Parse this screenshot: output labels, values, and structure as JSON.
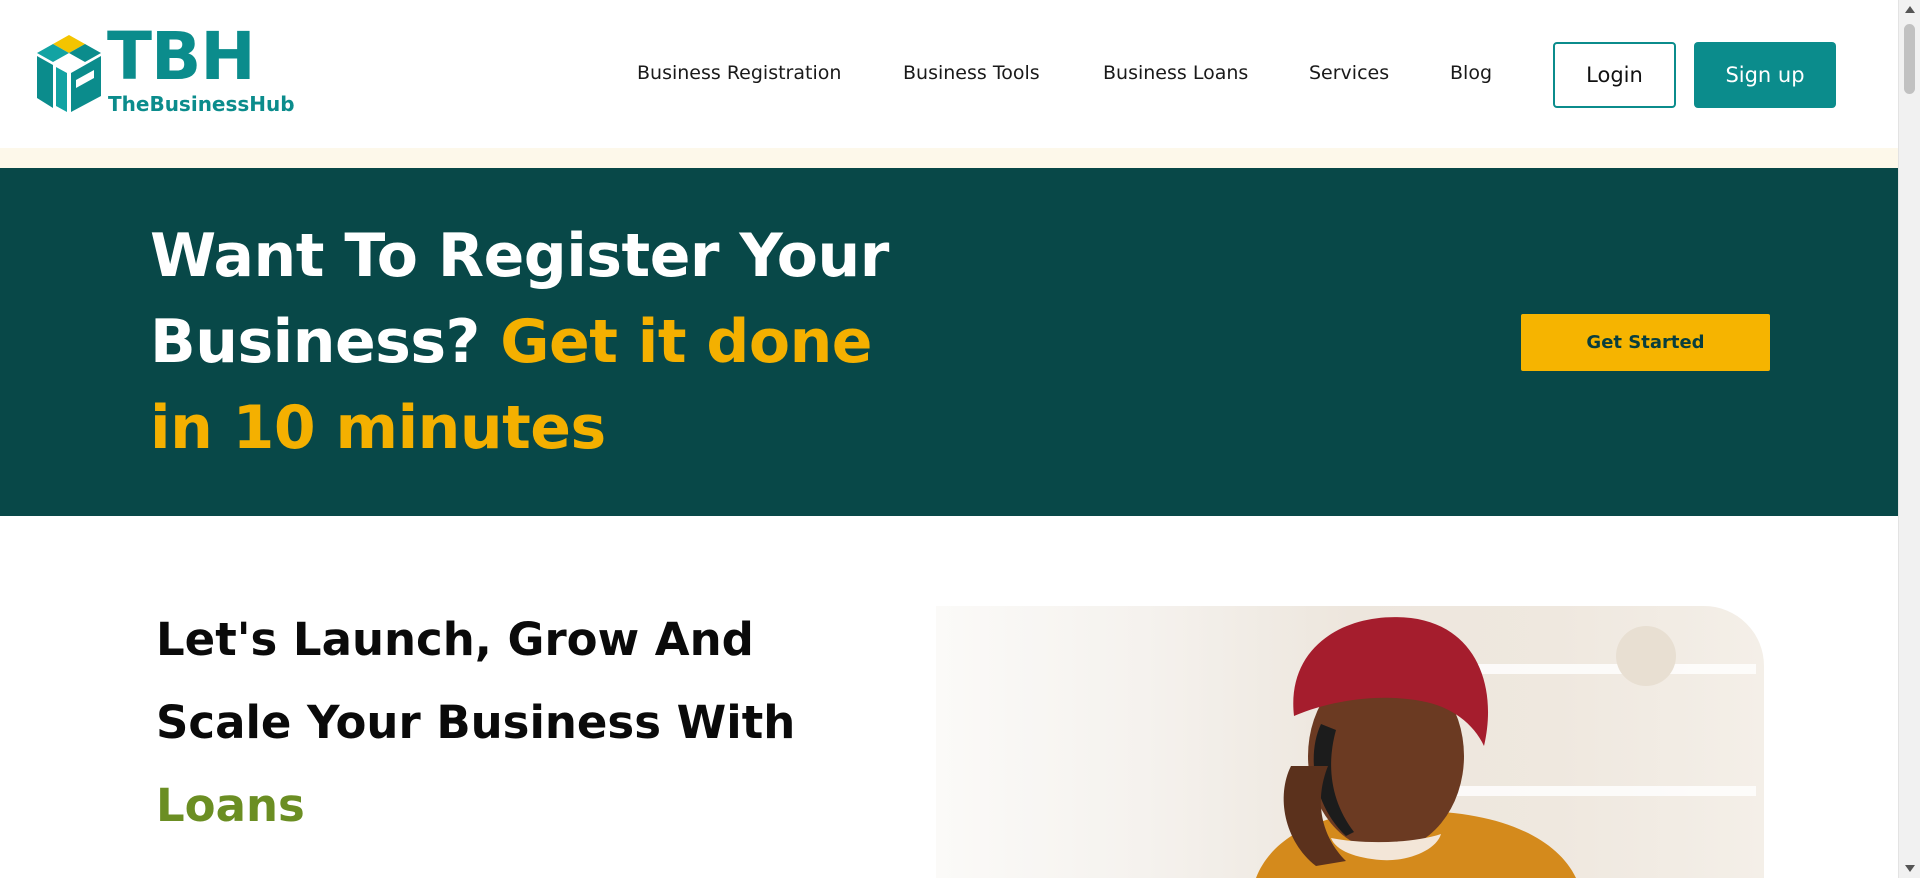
{
  "brand": {
    "logo_text": "TBH",
    "logo_subtitle": "TheBusinessHub",
    "primary_color": "#0b8c8c",
    "accent_color": "#f4b000",
    "hero_bg_color": "#084848",
    "green_accent": "#6b8e23"
  },
  "nav": {
    "items": [
      {
        "label": "Business Registration"
      },
      {
        "label": "Business Tools"
      },
      {
        "label": "Business Loans"
      },
      {
        "label": "Services"
      },
      {
        "label": "Blog"
      }
    ],
    "login_label": "Login",
    "signup_label": "Sign up"
  },
  "hero": {
    "title_white": "Want To Register Your Business? ",
    "title_highlight": "Get it done in 10 minutes",
    "cta_label": "Get Started"
  },
  "loans_section": {
    "title_plain": "Let's Launch, Grow And Scale Your Business With ",
    "title_highlight": "Loans",
    "image_icon": "woman-on-phone-photo"
  }
}
